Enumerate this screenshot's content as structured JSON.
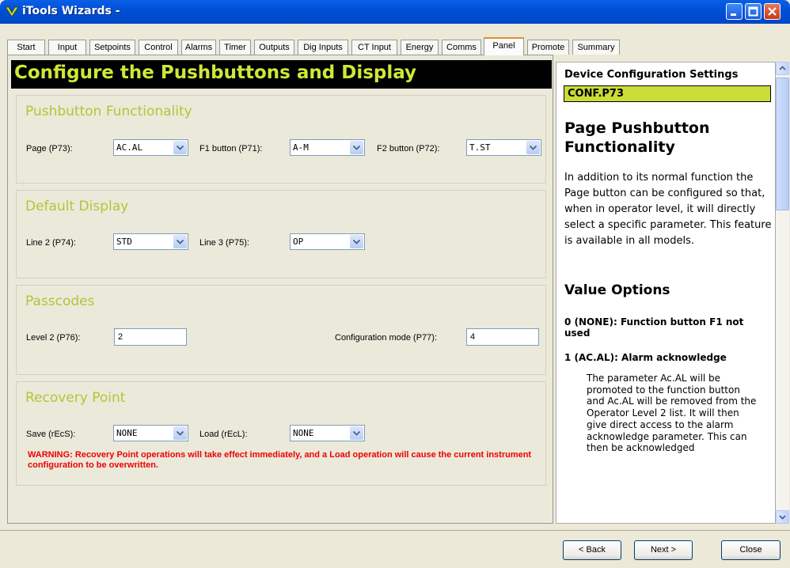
{
  "window": {
    "title": "iTools Wizards -"
  },
  "tabs": [
    "Start",
    "Input",
    "Setpoints",
    "Control",
    "Alarms",
    "Timer",
    "Outputs",
    "Dig Inputs",
    "CT Input",
    "Energy",
    "Comms",
    "Panel",
    "Promote",
    "Summary"
  ],
  "active_tab": "Panel",
  "header": {
    "title": "Configure the Pushbuttons and Display"
  },
  "pushbutton": {
    "title": "Pushbutton Functionality",
    "page_label": "Page (P73):",
    "page_value": "AC.AL",
    "f1_label": "F1 button (P71):",
    "f1_value": "A-M",
    "f2_label": "F2 button (P72):",
    "f2_value": "T.ST"
  },
  "display": {
    "title": "Default Display",
    "line2_label": "Line 2 (P74):",
    "line2_value": "STD",
    "line3_label": "Line 3 (P75):",
    "line3_value": "OP"
  },
  "passcodes": {
    "title": "Passcodes",
    "level2_label": "Level 2 (P76):",
    "level2_value": "2",
    "config_label": "Configuration mode (P77):",
    "config_value": "4"
  },
  "recovery": {
    "title": "Recovery Point",
    "save_label": "Save (rEcS):",
    "save_value": "NONE",
    "load_label": "Load (rEcL):",
    "load_value": "NONE",
    "warning": "WARNING: Recovery Point operations will take effect immediately, and a Load operation will cause the current instrument configuration to be overwritten."
  },
  "help": {
    "settings_title": "Device Configuration Settings",
    "code": "CONF.P73",
    "title": "Page Pushbutton Functionality",
    "body": "In addition to its normal function the Page button can be configured so that, when in operator level, it will directly select a specific parameter. This feature is available in all models.",
    "value_options": "Value Options",
    "option0": "0 (NONE): Function button F1 not used",
    "option1": "1 (AC.AL): Alarm acknowledge",
    "option1_desc": "The parameter Ac.AL will be promoted to the function button and Ac.AL will be removed from the Operator Level 2 list. It will then give direct access to the alarm acknowledge parameter. This can then be acknowledged"
  },
  "buttons": {
    "back": "< Back",
    "next": "Next >",
    "close": "Close"
  },
  "colors": {
    "accent_title": "#b4c437",
    "banner_text": "#cfe838",
    "code_bg": "#ccdc38",
    "warning": "#e00000",
    "titlebar": "#0050d8"
  }
}
